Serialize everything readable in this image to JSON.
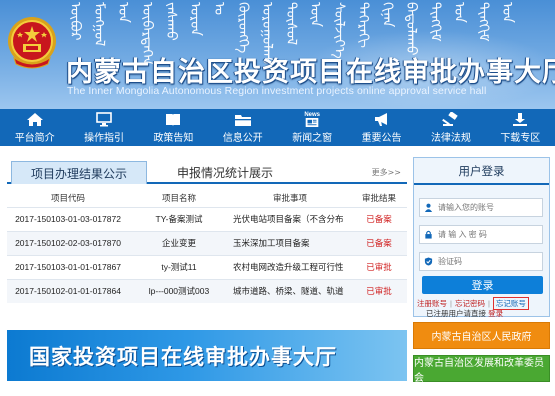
{
  "header": {
    "mongolian_script": [
      "ᠥᠪᠥᠷ",
      "ᠮᠣᠩᠭᠣᠯ",
      "ᠤᠨ",
      "ᠥᠪᠡᠷᠲᠡᠭᠡᠨ",
      "ᠵᠠᠰᠠᠬᠤ",
      "ᠣᠷᠤᠨ",
      "ᠤ",
      "ᠬᠥᠷᠥᠩᠭᠡ",
      "ᠣᠷᠤᠭᠤᠯᠬᠤ",
      "ᠲᠥᠰᠥᠯ",
      "ᠦᠨ",
      "ᠰᠦᠯᠵᠢᠶ᠎ᠡ",
      "ᠳᠡᠭᠡᠷᠡᠬᠢ",
      "ᠬᠢᠨᠠᠨ",
      "ᠪᠠᠲᠤᠯᠠᠬᠤ",
      "ᠲᠢᠩᠬᠢᠮ",
      "ᠤᠨ",
      "ᠲᠢᠩᠬᠢᠮ",
      "ᠤᠨ"
    ],
    "title_cn": "内蒙古自治区投资项目在线审批办事大厅",
    "title_en": "The Inner Mongolia Autonomous Region investment projects online approval service hall"
  },
  "nav": {
    "items": [
      {
        "label": "平台简介",
        "icon": "home-icon"
      },
      {
        "label": "操作指引",
        "icon": "monitor-icon"
      },
      {
        "label": "政策告知",
        "icon": "book-icon"
      },
      {
        "label": "信息公开",
        "icon": "folder-icon"
      },
      {
        "label": "新闻之窗",
        "icon": "news-icon",
        "tag": "News"
      },
      {
        "label": "重要公告",
        "icon": "megaphone-icon"
      },
      {
        "label": "法律法规",
        "icon": "gavel-icon"
      },
      {
        "label": "下载专区",
        "icon": "download-icon"
      }
    ]
  },
  "main": {
    "tabs": [
      {
        "label": "项目办理结果公示",
        "active": true
      },
      {
        "label": "申报情况统计展示",
        "active": false
      }
    ],
    "more": "更多>>",
    "table": {
      "headers": [
        "项目代码",
        "项目名称",
        "审批事项",
        "审批结果"
      ],
      "rows": [
        [
          "2017-150103-01-03-017872",
          "TY-备案测试",
          "光伏电站项目备案（不含分布",
          "已备案"
        ],
        [
          "2017-150102-02-03-017870",
          "企业变更",
          "玉米深加工项目备案",
          "已备案"
        ],
        [
          "2017-150103-01-01-017867",
          "ty-测试11",
          "农村电网改造升级工程可行性",
          "已审批"
        ],
        [
          "2017-150102-01-01-017864",
          "lp---000测试003",
          "城市道路、桥梁、隧道、轨道",
          "已审批"
        ]
      ]
    },
    "banner": "国家投资项目在线审批办事大厅"
  },
  "login": {
    "title": "用户登录",
    "username_placeholder": "请输入您的账号",
    "password_placeholder": "请 输 入 密 码",
    "captcha_placeholder": "验证码",
    "login_button": "登录",
    "register": "注册账号",
    "forgot_password": "忘记密码",
    "forgot_account": "忘记账号",
    "note_prefix": "已注册用户请直接",
    "note_link": "登录"
  },
  "side_links": {
    "gov": "内蒙古自治区人民政府",
    "ndrc": "内蒙古自治区发展和改革委员会"
  },
  "colors": {
    "nav_bg": "#1268b8",
    "status_red": "#d02020",
    "orange": "#f08c10",
    "green": "#4aa832"
  }
}
